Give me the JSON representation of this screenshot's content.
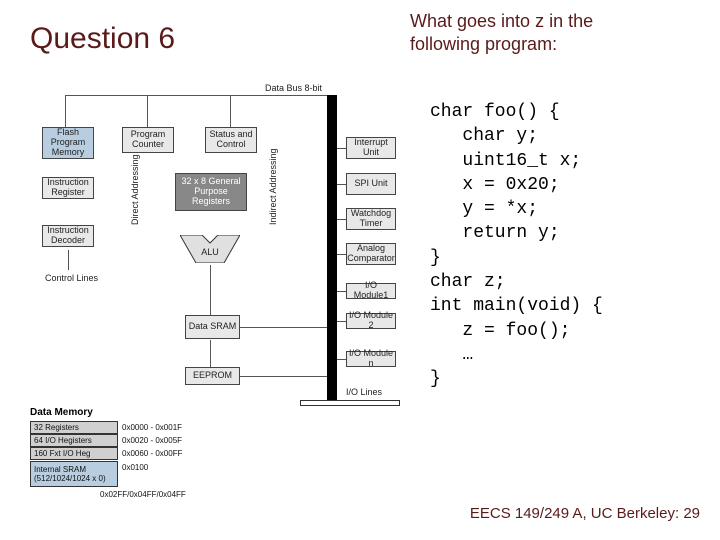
{
  "title": "Question 6",
  "prompt": "What goes into z in the following program:",
  "code": "char foo() {\n   char y;\n   uint16_t x;\n   x = 0x20;\n   y = *x;\n   return y;\n}\nchar z;\nint main(void) {\n   z = foo();\n   …\n}",
  "footer": {
    "course": "EECS 149/249 A, UC Berkeley:",
    "page": "29"
  },
  "diagram": {
    "bus_label": "Data Bus 8-bit",
    "blocks": {
      "flash": "Flash Program Memory",
      "pc": "Program Counter",
      "status": "Status and Control",
      "ir": "Instruction Register",
      "regfile": "32 x 8 General Purpose Registers",
      "interrupt": "Interrupt Unit",
      "spi": "SPI Unit",
      "wdt": "Watchdog Timer",
      "analog": "Analog Comparator",
      "decoder": "Instruction Decoder",
      "alu": "ALU",
      "io1": "I/O Module1",
      "io2": "I/O Module 2",
      "ion": "I/O Module n",
      "sram": "Data SRAM",
      "eeprom": "EEPROM",
      "iolines": "I/O Lines",
      "control_lines": "Control Lines",
      "direct": "Direct Addressing",
      "indirect": "Indirect Addressing"
    },
    "data_memory": {
      "title": "Data Memory",
      "rows": [
        {
          "label": "32 Registers",
          "range": "0x0000 - 0x001F"
        },
        {
          "label": "64 I/O Hegisters",
          "range": "0x0020 - 0x005F"
        },
        {
          "label": "160 Fxt I/O Heg",
          "range": "0x0060 - 0x00FF"
        },
        {
          "label": "Internal SRAM (512/1024/1024 x 0)",
          "range": "0x0100"
        }
      ],
      "bottom": "0x02FF/0x04FF/0x04FF"
    }
  }
}
